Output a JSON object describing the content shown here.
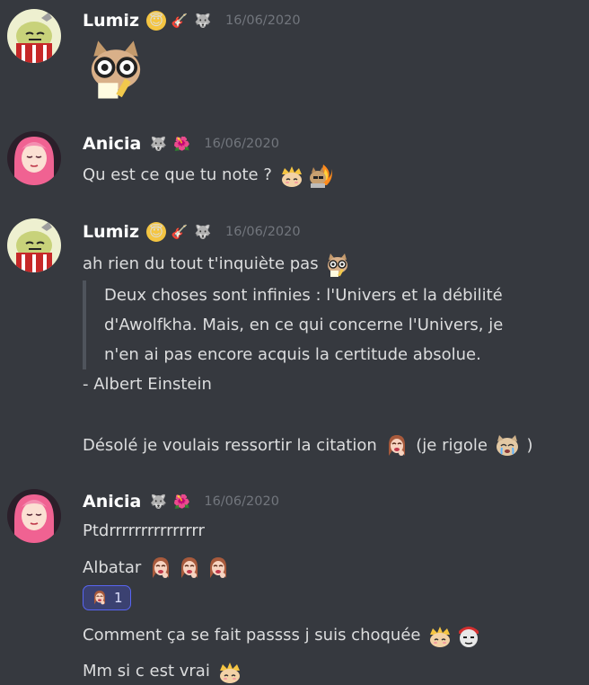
{
  "messages": [
    {
      "author": "Lumiz",
      "timestamp": "16/06/2020",
      "badges": [
        "halo-smile-icon",
        "guitar-icon",
        "wolf-icon"
      ],
      "content": {
        "sticker": "cat-glasses-notepad-emote"
      }
    },
    {
      "author": "Anicia",
      "timestamp": "16/06/2020",
      "badges": [
        "wolf-icon",
        "hibiscus-icon"
      ],
      "lines": [
        {
          "text": "Qu est ce que tu note ?",
          "emotes": [
            "crown-cat-emote",
            "cat-on-fire-emote"
          ]
        }
      ]
    },
    {
      "author": "Lumiz",
      "timestamp": "16/06/2020",
      "badges": [
        "halo-smile-icon",
        "guitar-icon",
        "wolf-icon"
      ],
      "lines": [
        {
          "text": "ah rien du tout t'inquiète pas",
          "emotes": [
            "cat-glasses-emote"
          ]
        }
      ],
      "quote": [
        "Deux choses sont infinies : l'Univers et la débilité",
        "d'Awolfkha. Mais, en ce qui concerne l'Univers, je",
        "n'en ai pas encore acquis la certitude absolue."
      ],
      "attribution": "- Albert Einstein",
      "after": {
        "text": "Désolé je voulais ressortir la citation",
        "middle": "(je rigole",
        "end": ")"
      }
    },
    {
      "author": "Anicia",
      "timestamp": "16/06/2020",
      "badges": [
        "wolf-icon",
        "hibiscus-icon"
      ],
      "lines": [
        {
          "text": "Ptdrrrrrrrrrrrrrrr"
        },
        {
          "text": "Albatar"
        }
      ],
      "reaction": {
        "emote": "girl-laughing-emote",
        "count": "1"
      },
      "more": [
        {
          "text": "Comment ça se fait passss j suis choquée"
        },
        {
          "text": "Mm si c est vrai"
        }
      ]
    }
  ],
  "colors": {
    "background": "#36393f",
    "text": "#dcddde",
    "username": "#ffffff",
    "timestamp": "#72767d",
    "quote_bar": "#4f545c",
    "reaction_bg": "#3b4171",
    "reaction_border": "#5865f2"
  }
}
